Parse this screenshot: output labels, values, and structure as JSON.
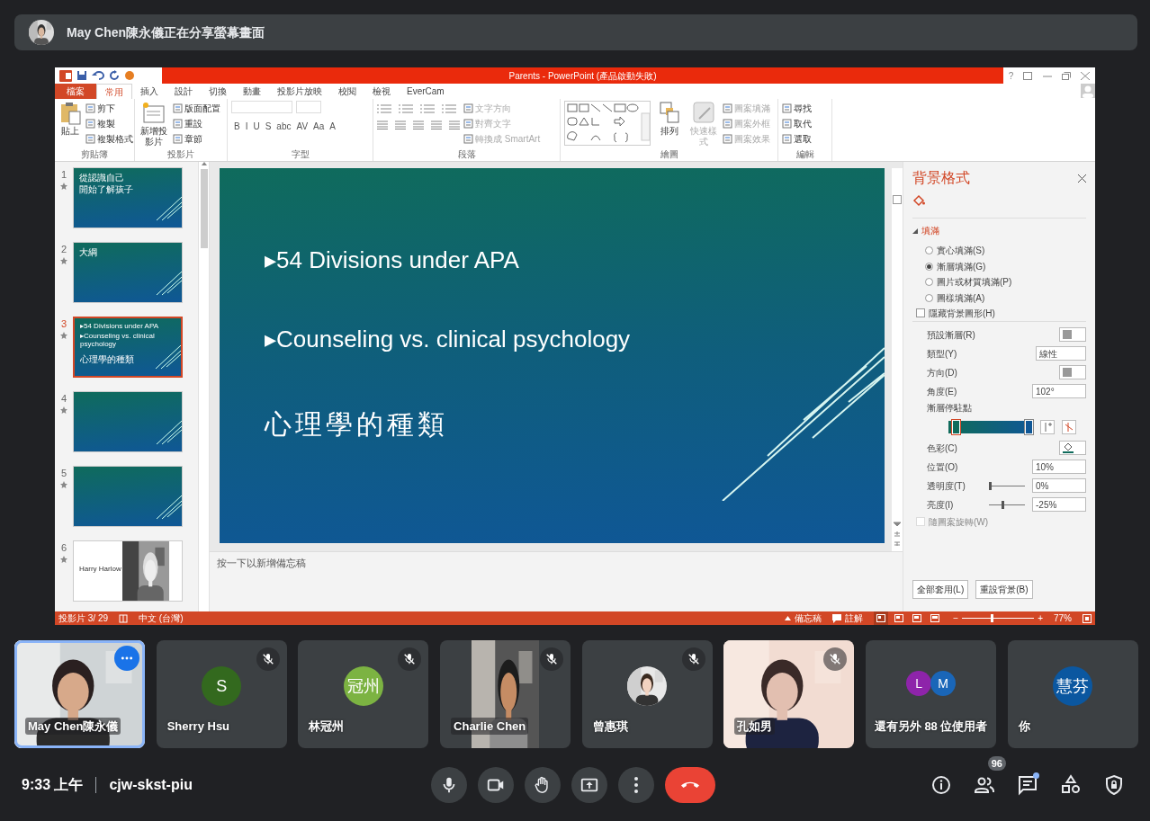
{
  "banner": {
    "text": "May Chen陳永儀正在分享螢幕畫面"
  },
  "ppt": {
    "title": "Parents - PowerPoint (產品啟動失敗)",
    "help": "?",
    "tabs": [
      {
        "label": "檔案",
        "kind": "file",
        "selected": false
      },
      {
        "label": "常用",
        "kind": "tab",
        "selected": true
      },
      {
        "label": "插入",
        "kind": "tab",
        "selected": false
      },
      {
        "label": "設計",
        "kind": "tab",
        "selected": false
      },
      {
        "label": "切換",
        "kind": "tab",
        "selected": false
      },
      {
        "label": "動畫",
        "kind": "tab",
        "selected": false
      },
      {
        "label": "投影片放映",
        "kind": "tab",
        "selected": false
      },
      {
        "label": "校閱",
        "kind": "tab",
        "selected": false
      },
      {
        "label": "檢視",
        "kind": "tab",
        "selected": false
      },
      {
        "label": "EverCam",
        "kind": "tab",
        "selected": false
      }
    ],
    "groups": [
      {
        "label": "剪貼簿",
        "kind": "standard",
        "large": [
          {
            "label": "貼上",
            "disabled": false
          }
        ],
        "small": [
          {
            "label": "剪下",
            "disabled": false
          },
          {
            "label": "複製",
            "disabled": false
          },
          {
            "label": "複製格式",
            "disabled": false
          }
        ]
      },
      {
        "label": "投影片",
        "kind": "standard",
        "large": [
          {
            "label": "新增投影片",
            "disabled": false
          }
        ],
        "small": [
          {
            "label": "版面配置",
            "disabled": false
          },
          {
            "label": "重設",
            "disabled": false
          },
          {
            "label": "章節",
            "disabled": false
          }
        ]
      },
      {
        "label": "字型",
        "kind": "font",
        "format_buttons": [
          "B",
          "I",
          "U",
          "S",
          "abc",
          "AV",
          "Aa",
          "A"
        ]
      },
      {
        "label": "段落",
        "kind": "paragraph",
        "small": [
          {
            "label": "文字方向",
            "disabled": true
          },
          {
            "label": "對齊文字",
            "disabled": true
          },
          {
            "label": "轉換成 SmartArt",
            "disabled": true
          }
        ]
      },
      {
        "label": "繪圖",
        "kind": "drawing",
        "large": [
          {
            "label": "排列",
            "disabled": false
          },
          {
            "label": "快速樣式",
            "disabled": true
          }
        ],
        "small": [
          {
            "label": "圖案填滿",
            "disabled": true
          },
          {
            "label": "圖案外框",
            "disabled": true
          },
          {
            "label": "圖案效果",
            "disabled": true
          }
        ]
      },
      {
        "label": "編輯",
        "kind": "standard",
        "small": [
          {
            "label": "尋找",
            "disabled": false
          },
          {
            "label": "取代",
            "disabled": false
          },
          {
            "label": "選取",
            "disabled": false
          }
        ]
      }
    ],
    "thumbnails": [
      {
        "number": "1",
        "selected": false,
        "kind": "text",
        "lines": [
          "從認識自己",
          "開始了解孩子"
        ]
      },
      {
        "number": "2",
        "selected": false,
        "kind": "text",
        "lines": [
          "大綱"
        ]
      },
      {
        "number": "3",
        "selected": true,
        "kind": "text",
        "lines": [
          "▸54 Divisions under APA",
          "▸Counseling vs. clinical psychology",
          "心理學的種類"
        ]
      },
      {
        "number": "4",
        "selected": false,
        "kind": "text"
      },
      {
        "number": "5",
        "selected": false,
        "kind": "text"
      },
      {
        "number": "6",
        "selected": false,
        "lines": [
          "Harry Harlow"
        ]
      }
    ],
    "slide": {
      "bullets": [
        "▸54 Divisions under APA",
        "▸Counseling vs. clinical psychology"
      ],
      "heading": "心理學的種類"
    },
    "notes_placeholder": "按一下以新增備忘稿",
    "format_pane": {
      "title": "背景格式",
      "section": {
        "label": "填滿",
        "expanded": true
      },
      "fill_options": [
        {
          "label": "實心填滿(S)",
          "selected": false
        },
        {
          "label": "漸層填滿(G)",
          "selected": true
        },
        {
          "label": "圖片或材質填滿(P)",
          "selected": false
        },
        {
          "label": "圖樣填滿(A)",
          "selected": false
        }
      ],
      "hide_graphics": {
        "label": "隱藏背景圖形(H)",
        "checked": false
      },
      "rows": [
        {
          "label": "預設漸層(R)",
          "kind": "swatch"
        },
        {
          "label": "類型(Y)",
          "kind": "select",
          "value": "線性"
        },
        {
          "label": "方向(D)",
          "kind": "swatch"
        },
        {
          "label": "角度(E)",
          "kind": "spin",
          "value": "102°"
        },
        {
          "label": "漸層停駐點",
          "kind": "stops",
          "stops": [
            {
              "color": "#0f6b5c",
              "level": 0.05,
              "selected": true
            },
            {
              "color": "#0f5796",
              "level": 1,
              "selected": false
            }
          ]
        },
        {
          "label": "色彩(C)",
          "kind": "color"
        },
        {
          "label": "位置(O)",
          "kind": "spin",
          "value": "10%"
        },
        {
          "label": "透明度(T)",
          "kind": "slider",
          "level": 0,
          "value": "0%"
        },
        {
          "label": "亮度(I)",
          "kind": "slider",
          "level": 0.35,
          "value": "-25%"
        }
      ],
      "rotate_with_shape": {
        "label": "隨圖案旋轉(W)",
        "checked": false,
        "disabled": true
      },
      "buttons": [
        "全部套用(L)",
        "重設背景(B)"
      ]
    },
    "status": {
      "slide_info": "投影片 3/ 29",
      "language": "中文 (台灣)",
      "notes": "備忘稿",
      "comments": "註解",
      "views": [
        {
          "selected": true
        },
        {
          "selected": false
        },
        {
          "selected": false
        },
        {
          "selected": false
        }
      ],
      "zoom_out": "−",
      "zoom_in": "+",
      "zoom": {
        "level": 0.4,
        "value": "77%"
      }
    }
  },
  "participants": [
    {
      "name": "May Chen陳永儀",
      "kind": "video",
      "speaking": true,
      "muted": false,
      "menu": true
    },
    {
      "name": "Sherry Hsu",
      "kind": "avatar",
      "initial": "S",
      "color": "#33691e",
      "speaking": false,
      "muted": true,
      "menu": false
    },
    {
      "name": "林冠州",
      "kind": "avatar",
      "initial": "冠州",
      "color": "#7cb342",
      "speaking": false,
      "muted": true,
      "menu": false
    },
    {
      "name": "Charlie Chen",
      "kind": "video",
      "speaking": false,
      "muted": true,
      "menu": false
    },
    {
      "name": "曾惠琪",
      "speaking": false,
      "muted": true,
      "menu": false
    },
    {
      "name": "孔如男",
      "kind": "video",
      "speaking": false,
      "muted": true,
      "menu": false
    },
    {
      "name": "還有另外 88 位使用者",
      "kind": "group",
      "avatars": [
        {
          "initial": "L",
          "color": "#8e24aa"
        },
        {
          "initial": "M",
          "color": "#1a66b8"
        }
      ],
      "speaking": false,
      "muted": false,
      "menu": false
    },
    {
      "name": "你",
      "kind": "avatar",
      "initial": "慧芬",
      "color": "#0b57a0",
      "speaking": false,
      "muted": false,
      "menu": false
    }
  ],
  "bottom": {
    "time": "9:33 上午",
    "meeting_code": "cjw-skst-piu",
    "controls": [
      {
        "kind": "mic"
      },
      {
        "kind": "camera"
      },
      {
        "kind": "hand"
      },
      {
        "kind": "present"
      },
      {
        "kind": "more"
      },
      {
        "kind": "end_call"
      }
    ],
    "right": [
      {
        "kind": "info",
        "notify": false
      },
      {
        "kind": "people",
        "badge": "96",
        "notify": false
      },
      {
        "kind": "chat",
        "notify": true
      },
      {
        "kind": "activities",
        "notify": false
      },
      {
        "kind": "host",
        "notify": false
      }
    ]
  }
}
